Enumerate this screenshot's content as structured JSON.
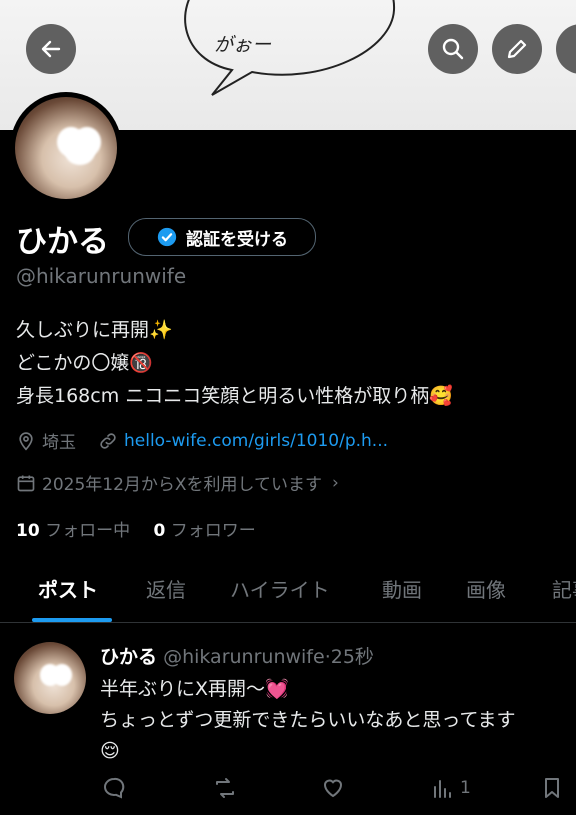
{
  "banner": {
    "bubble_text": "がぉー"
  },
  "profile": {
    "name": "ひかる",
    "verify_label": "認証を受ける",
    "handle": "@hikarunrunwife",
    "bio_lines": [
      "久しぶりに再開✨",
      "どこかの〇嬢🔞",
      "身長168cm ニコニコ笑顔と明るい性格が取り柄🥰"
    ],
    "location": "埼玉",
    "website": "hello-wife.com/girls/1010/p.h...",
    "joined": "2025年12月からXを利用しています",
    "following_count": "10",
    "following_label": "フォロー中",
    "followers_count": "0",
    "followers_label": "フォロワー"
  },
  "tabs": [
    "ポスト",
    "返信",
    "ハイライト",
    "動画",
    "画像",
    "記事"
  ],
  "post": {
    "name": "ひかる",
    "handle": "@hikarunrunwife",
    "time": "25秒",
    "line1": "半年ぶりにX再開〜💓",
    "line2": "ちょっとずつ更新できたらいいなあと思ってます",
    "line3": "😌",
    "views": "1"
  },
  "icons": [
    "back-arrow-icon",
    "search-icon",
    "pencil-icon",
    "location-pin-icon",
    "link-icon",
    "calendar-icon",
    "verified-badge-icon",
    "reply-icon",
    "repost-icon",
    "like-icon",
    "views-icon",
    "bookmark-icon"
  ],
  "colors": {
    "accent": "#1d9bf0",
    "background": "#000000",
    "secondary_text": "#71767b"
  }
}
